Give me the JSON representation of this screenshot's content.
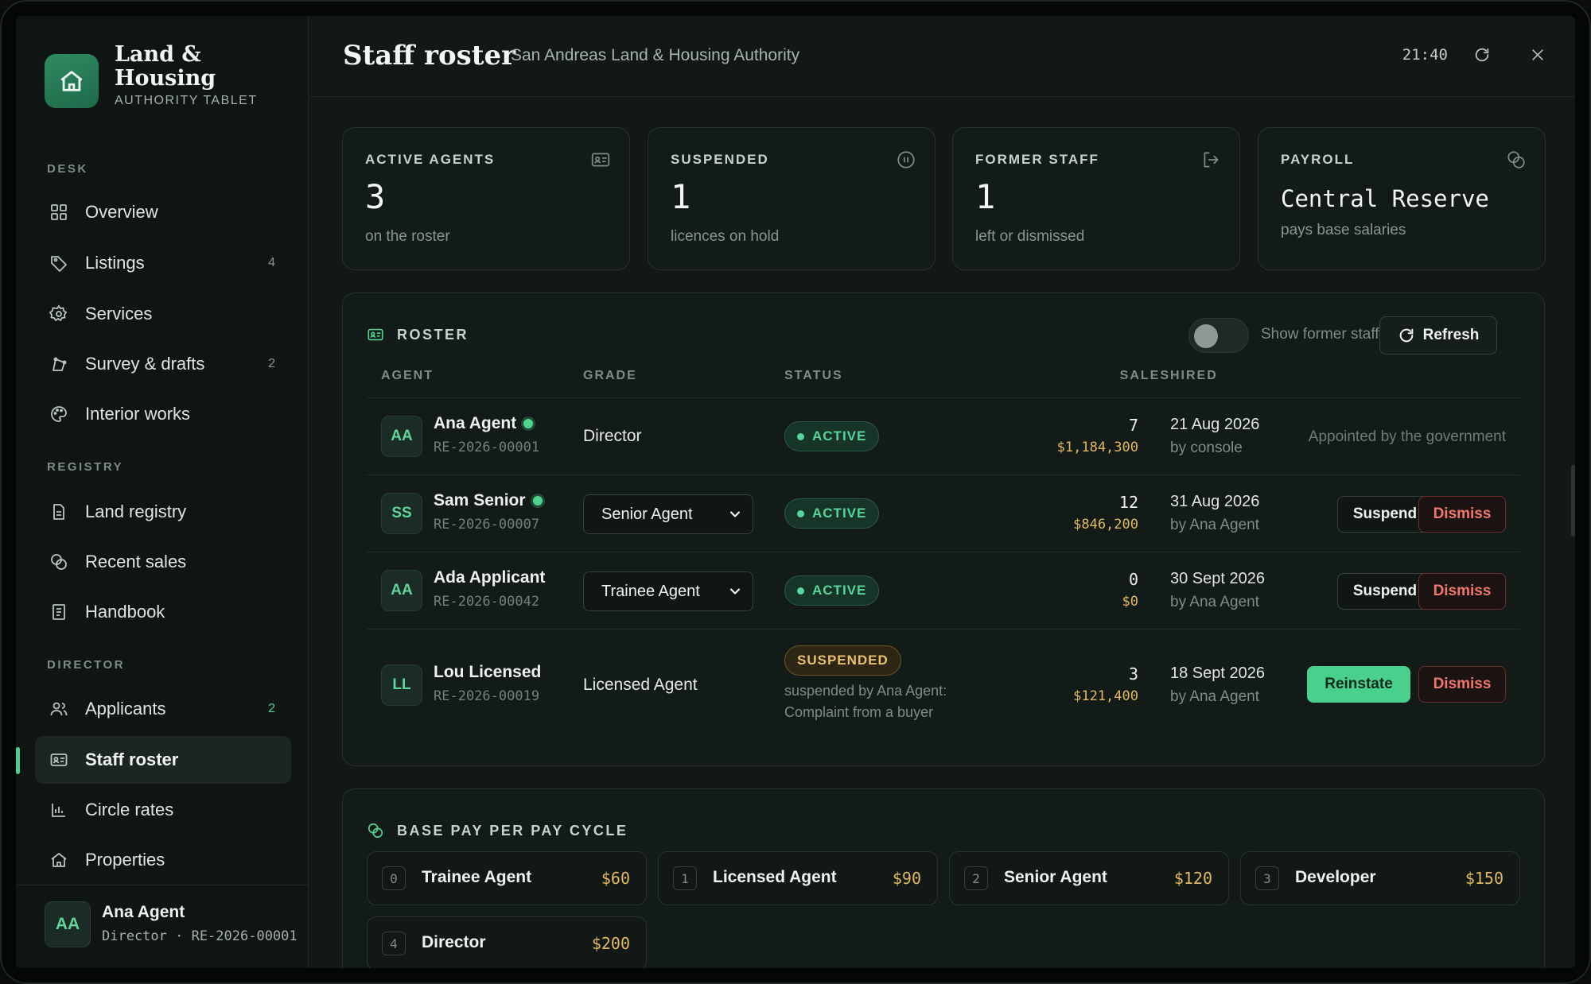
{
  "brand": {
    "title": "Land & Housing",
    "subtitle": "AUTHORITY TABLET"
  },
  "sidebar": {
    "sections": {
      "desk": "DESK",
      "registry": "REGISTRY",
      "director": "DIRECTOR"
    },
    "items": [
      {
        "label": "Overview",
        "icon": "grid-icon",
        "count": ""
      },
      {
        "label": "Listings",
        "icon": "tag-icon",
        "count": "4"
      },
      {
        "label": "Services",
        "icon": "gear-icon",
        "count": ""
      },
      {
        "label": "Survey & drafts",
        "icon": "survey-icon",
        "count": "2"
      },
      {
        "label": "Interior works",
        "icon": "palette-icon",
        "count": ""
      },
      {
        "label": "Land registry",
        "icon": "document-icon",
        "count": ""
      },
      {
        "label": "Recent sales",
        "icon": "coins-icon",
        "count": ""
      },
      {
        "label": "Handbook",
        "icon": "book-icon",
        "count": ""
      },
      {
        "label": "Applicants",
        "icon": "users-icon",
        "count": "2"
      },
      {
        "label": "Staff roster",
        "icon": "id-card-icon",
        "count": ""
      },
      {
        "label": "Circle rates",
        "icon": "bar-chart-icon",
        "count": ""
      },
      {
        "label": "Properties",
        "icon": "home-icon",
        "count": ""
      }
    ],
    "active_item": "Staff roster",
    "user": {
      "initials": "AA",
      "name": "Ana Agent",
      "meta": "Director · RE-2026-00001"
    }
  },
  "header": {
    "title": "Staff roster",
    "subtitle": "San Andreas Land & Housing Authority",
    "time": "21:40"
  },
  "stats": [
    {
      "label": "ACTIVE AGENTS",
      "value": "3",
      "note": "on the roster",
      "icon": "id-card-icon"
    },
    {
      "label": "SUSPENDED",
      "value": "1",
      "note": "licences on hold",
      "icon": "pause-icon"
    },
    {
      "label": "FORMER STAFF",
      "value": "1",
      "note": "left or dismissed",
      "icon": "logout-icon"
    },
    {
      "label": "PAYROLL",
      "value": "Central Reserve",
      "note": "pays base salaries",
      "icon": "coins-icon"
    }
  ],
  "roster": {
    "title": "ROSTER",
    "toggle_label": "Show former staff",
    "toggle_on": false,
    "refresh_label": "Refresh",
    "columns": {
      "agent": "AGENT",
      "grade": "GRADE",
      "status": "STATUS",
      "sales": "SALES",
      "hired": "HIRED"
    },
    "rows": [
      {
        "initials": "AA",
        "name": "Ana Agent",
        "online": true,
        "id": "RE-2026-00001",
        "grade": "Director",
        "grade_editable": false,
        "status": "ACTIVE",
        "status_note": "",
        "sales_count": "7",
        "sales_amount": "$1,184,300",
        "hired_date": "21 Aug 2026",
        "hired_by": "by console",
        "note": "Appointed by the government",
        "actions": []
      },
      {
        "initials": "SS",
        "name": "Sam Senior",
        "online": true,
        "id": "RE-2026-00007",
        "grade": "Senior Agent",
        "grade_editable": true,
        "status": "ACTIVE",
        "status_note": "",
        "sales_count": "12",
        "sales_amount": "$846,200",
        "hired_date": "31 Aug 2026",
        "hired_by": "by Ana Agent",
        "note": "",
        "actions": [
          "Suspend",
          "Dismiss"
        ]
      },
      {
        "initials": "AA",
        "name": "Ada Applicant",
        "online": false,
        "id": "RE-2026-00042",
        "grade": "Trainee Agent",
        "grade_editable": true,
        "status": "ACTIVE",
        "status_note": "",
        "sales_count": "0",
        "sales_amount": "$0",
        "hired_date": "30 Sept 2026",
        "hired_by": "by Ana Agent",
        "note": "",
        "actions": [
          "Suspend",
          "Dismiss"
        ]
      },
      {
        "initials": "LL",
        "name": "Lou Licensed",
        "online": false,
        "id": "RE-2026-00019",
        "grade": "Licensed Agent",
        "grade_editable": false,
        "status": "SUSPENDED",
        "status_note": "suspended by Ana Agent: Complaint from a buyer",
        "sales_count": "3",
        "sales_amount": "$121,400",
        "hired_date": "18 Sept 2026",
        "hired_by": "by Ana Agent",
        "note": "",
        "actions": [
          "Reinstate",
          "Dismiss"
        ]
      }
    ]
  },
  "payscale": {
    "title": "BASE PAY PER PAY CYCLE",
    "grades": [
      {
        "index": "0",
        "name": "Trainee Agent",
        "amount": "$60"
      },
      {
        "index": "1",
        "name": "Licensed Agent",
        "amount": "$90"
      },
      {
        "index": "2",
        "name": "Senior Agent",
        "amount": "$120"
      },
      {
        "index": "3",
        "name": "Developer",
        "amount": "$150"
      },
      {
        "index": "4",
        "name": "Director",
        "amount": "$200"
      }
    ]
  },
  "colors": {
    "accent": "#49d08c",
    "money": "#e4b85d",
    "danger": "#f2776b",
    "warning": "#e8c16a"
  }
}
